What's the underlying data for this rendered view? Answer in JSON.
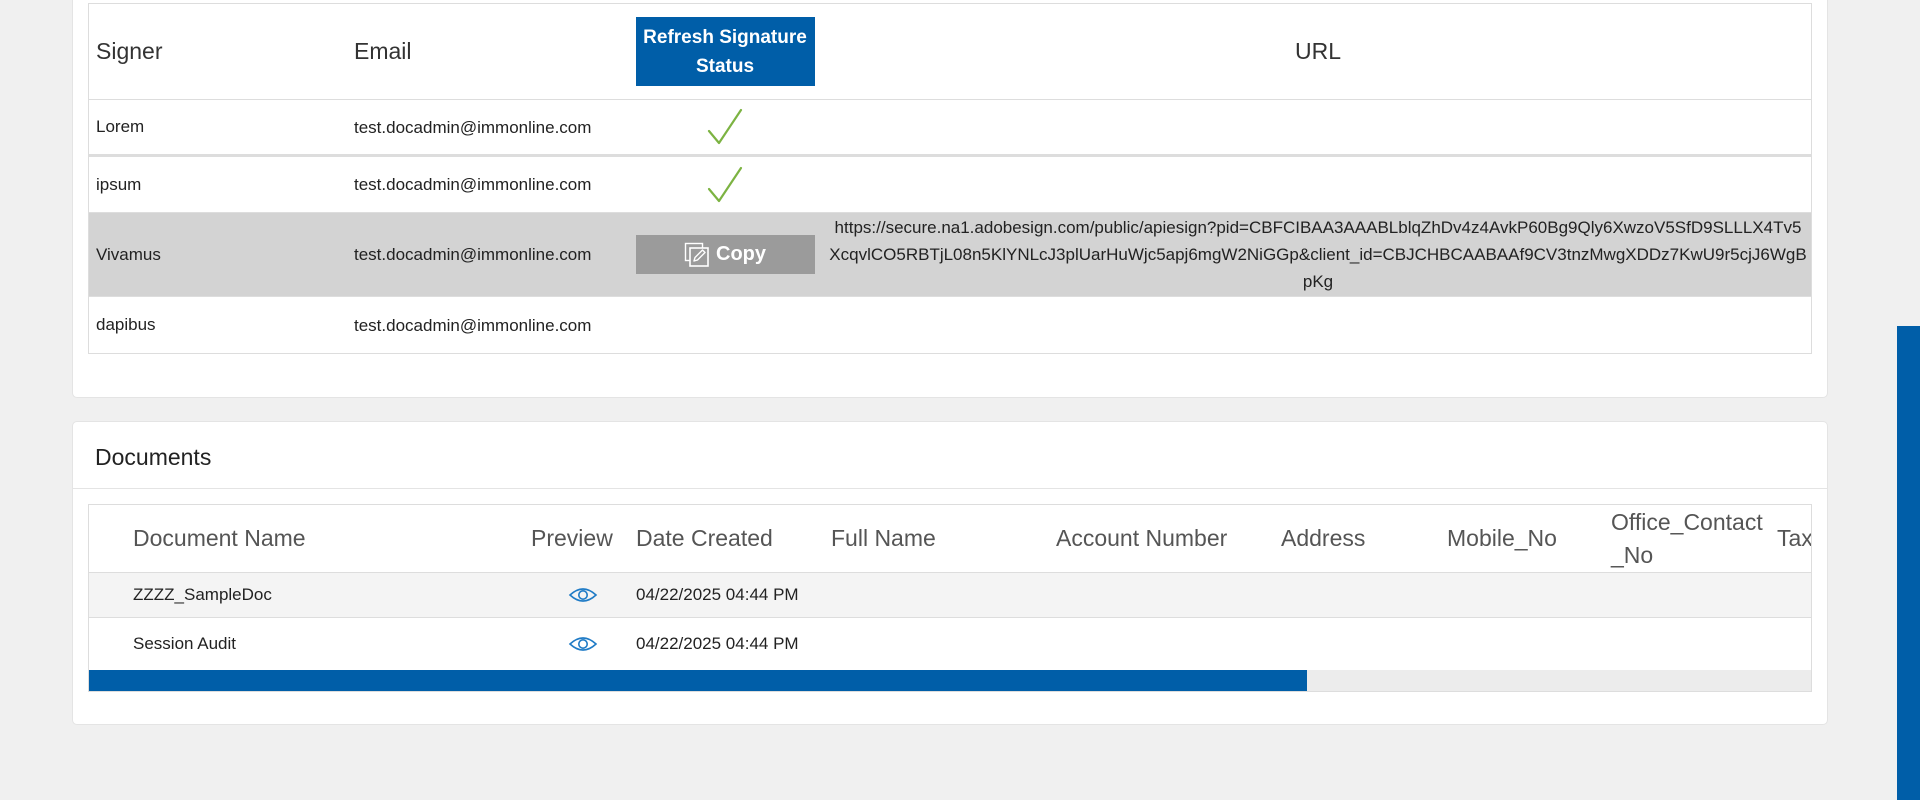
{
  "signers": {
    "headers": {
      "signer": "Signer",
      "email": "Email",
      "refresh_button": "Refresh Signature Status",
      "url": "URL"
    },
    "rows": [
      {
        "signer": "Lorem",
        "email": "test.docadmin@immonline.com",
        "status": "signed",
        "url": ""
      },
      {
        "signer": "ipsum",
        "email": "test.docadmin@immonline.com",
        "status": "signed",
        "url": ""
      },
      {
        "signer": "Vivamus",
        "email": "test.docadmin@immonline.com",
        "status": "copy",
        "copy_label": "Copy",
        "url": "https://secure.na1.adobesign.com/public/apiesign?pid=CBFCIBAA3AAABLblqZhDv4z4AvkP60Bg9Qly6XwzoV5SfD9SLLLX4Tv5XcqvlCO5RBTjL08n5KlYNLcJ3plUarHuWjc5apj6mgW2NiGGp&client_id=CBJCHBCAABAAf9CV3tnzMwgXDDz7KwU9r5cjJ6WgBpKg"
      },
      {
        "signer": "dapibus",
        "email": "test.docadmin@immonline.com",
        "status": "",
        "url": ""
      }
    ]
  },
  "documents": {
    "title": "Documents",
    "headers": {
      "document_name": "Document Name",
      "preview": "Preview",
      "date_created": "Date Created",
      "full_name": "Full Name",
      "account_number": "Account Number",
      "address": "Address",
      "mobile_no": "Mobile_No",
      "office_contact_no": "Office_Contact_No",
      "tax": "Tax"
    },
    "rows": [
      {
        "name": "ZZZZ_SampleDoc",
        "date": "04/22/2025 04:44 PM"
      },
      {
        "name": "Session Audit",
        "date": "04/22/2025 04:44 PM"
      }
    ],
    "horizontal_scroll_fraction": 0.71
  },
  "colors": {
    "accent": "#005ea8",
    "check": "#7cb342",
    "row_highlight": "#d3d3d3"
  },
  "icons": {
    "signed": "check-icon",
    "copy": "copy-icon",
    "preview": "eye-icon"
  }
}
